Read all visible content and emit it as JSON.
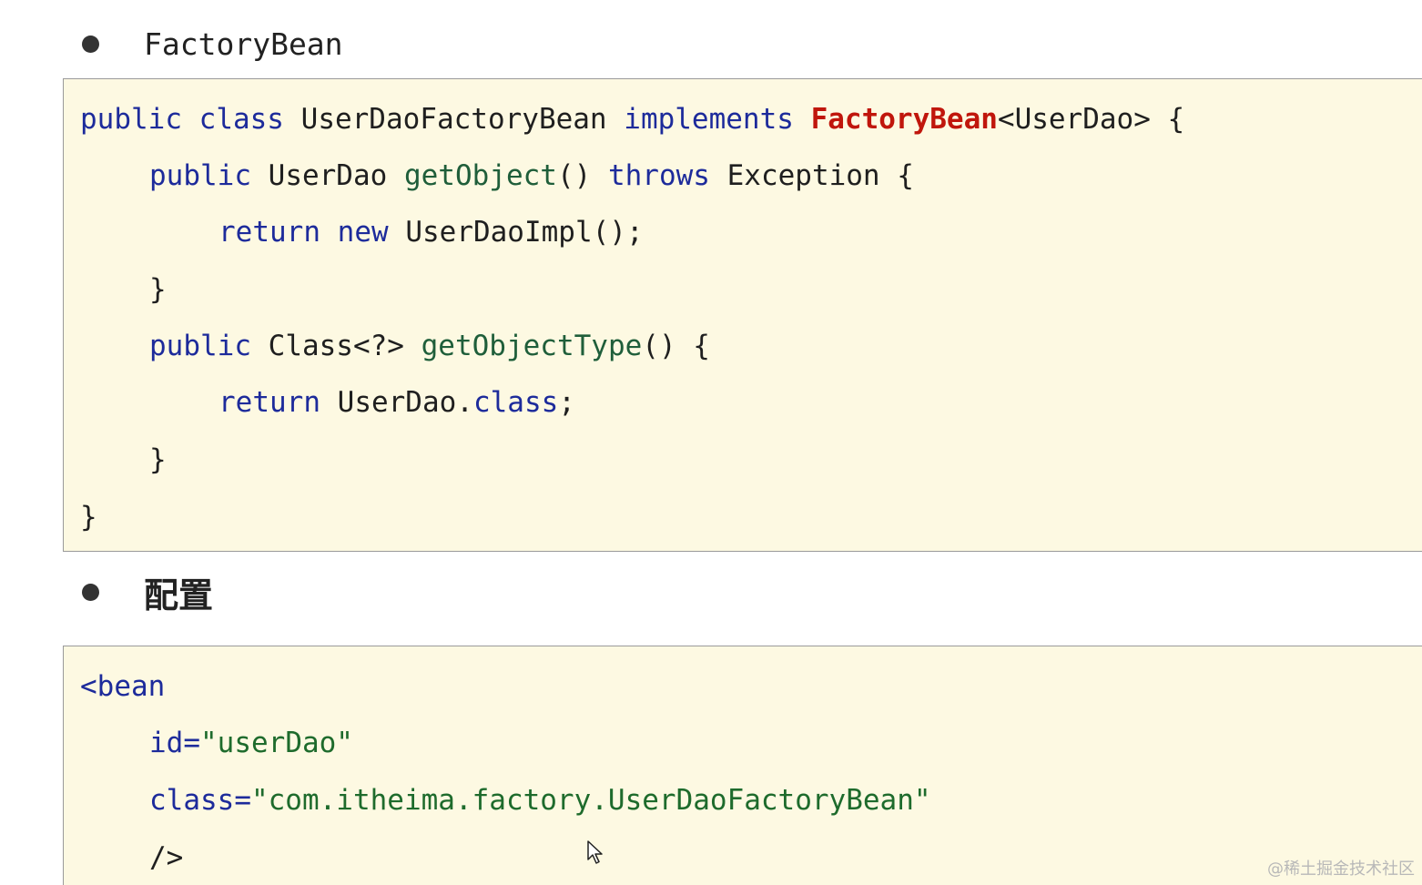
{
  "sections": [
    {
      "bullet": "FactoryBean"
    },
    {
      "bullet": "配置"
    }
  ],
  "java_code": {
    "l1": {
      "kw_public": "public",
      "kw_class": "class",
      "name": "UserDaoFactoryBean",
      "kw_impl": "implements",
      "iface": "FactoryBean",
      "generic": "<UserDao> {"
    },
    "l2": {
      "kw_public": "public",
      "type": "UserDao",
      "method": "getObject",
      "paren": "()",
      "kw_throws": "throws",
      "rest": "Exception {"
    },
    "l3": {
      "kw_return": "return",
      "kw_new": "new",
      "rest": "UserDaoImpl();"
    },
    "l4": {
      "brace": "}"
    },
    "l5": {
      "kw_public": "public",
      "type": "Class<?>",
      "method": "getObjectType",
      "rest": "() {"
    },
    "l6": {
      "kw_return": "return",
      "obj": "UserDao.",
      "kw_class": "class",
      "semi": ";"
    },
    "l7": {
      "brace": "}"
    },
    "l8": {
      "brace": "}"
    }
  },
  "xml_code": {
    "l1": "<bean",
    "l2": {
      "attr": "id=",
      "value": "\"userDao\""
    },
    "l3": {
      "attr": "class=",
      "value": "\"com.itheima.factory.UserDaoFactoryBean\""
    },
    "l4": "/>"
  },
  "watermark": "@稀土掘金技术社区",
  "colors": {
    "code_background": "#fdf9e2",
    "keyword": "#1d2b9b",
    "method": "#1f5e3a",
    "highlight": "#c0160c",
    "string": "#1e6b2c"
  },
  "icons": [
    "bullet-dot",
    "mouse-pointer-icon"
  ]
}
